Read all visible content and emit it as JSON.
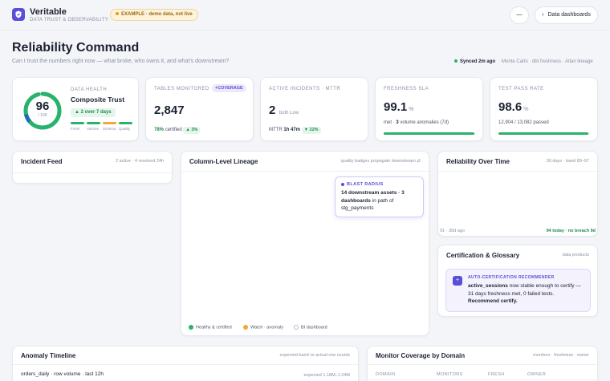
{
  "app": {
    "name": "Veritable",
    "tagline": "DATA TRUST & OBSERVABILITY"
  },
  "banner": {
    "label": "EXAMPLE · demo data, not live"
  },
  "header": {
    "menu_label": "—",
    "back_label": "Data dashboards"
  },
  "page": {
    "title": "Reliability Command",
    "subtitle": "Can I trust the numbers right now — what broke, who owns it, and what's downstream?",
    "sync_status": "Synced 2m ago",
    "sources": "Monte Carlo · dbt freshness · Atlan lineage"
  },
  "health": {
    "label": "DATA HEALTH",
    "score": "96",
    "score_sub": "/ 100",
    "score_value": 96,
    "title": "Composite Trust",
    "delta": "▲ 2 over 7 days",
    "segments": [
      {
        "label": "Fresh",
        "color": "#27b36b"
      },
      {
        "label": "Volume",
        "color": "#27b36b"
      },
      {
        "label": "Schema",
        "color": "#f0a838"
      },
      {
        "label": "Quality",
        "color": "#27b36b"
      }
    ],
    "ring_color": "#27b36b",
    "ring_accent": "#1d6fb8"
  },
  "kpis": {
    "tables": {
      "label": "TABLES MONITORED",
      "badge": "+COVERAGE",
      "value": "2,847",
      "pct": "78%",
      "pct_text": "certified",
      "delta": "▲ 3%"
    },
    "incidents": {
      "label": "ACTIVE INCIDENTS · MTTR",
      "value": "2",
      "value_note": "both Low",
      "mttr_label": "MTTR",
      "mttr_value": "1h 47m",
      "delta": "▼ 22%"
    },
    "freshness": {
      "label": "FRESHNESS SLA",
      "value": "99.1",
      "unit": "%",
      "detail_pre": "met ·",
      "detail_bold": "3",
      "detail_post": "volume anomalies (7d)",
      "progress": 0.991
    },
    "tests": {
      "label": "TEST PASS RATE",
      "value": "98.6",
      "unit": "%",
      "detail": "12,904 / 13,082 passed",
      "progress": 0.986
    }
  },
  "incident_feed": {
    "title": "Incident Feed",
    "meta": "2 active · 4 resolved 24h"
  },
  "lineage": {
    "title": "Column-Level Lineage",
    "meta": "quality badges propagate downstream ⇄",
    "callout_label": "BLAST RADIUS",
    "callout_bold": "14 downstream assets · 3 dashboards",
    "callout_text": "in path of stg_payments",
    "legend": [
      {
        "label": "Healthy & certified",
        "color": "#27b36b"
      },
      {
        "label": "Watch · anomaly",
        "color": "#f0a838"
      },
      {
        "label": "BI dashboard",
        "color": "#ffffff"
      }
    ]
  },
  "reliability": {
    "title": "Reliability Over Time",
    "meta": "30 days · band 89–97",
    "left_label": "91 · 30d ago",
    "right_label": "94 today · no breach 9d"
  },
  "certification": {
    "title": "Certification & Glossary",
    "meta": "data products",
    "rec_label": "AUTO-CERTIFICATION RECOMMENDER",
    "rec_bold": "active_sessions",
    "rec_text": "now stable enough to certify — 31 days freshness met, 0 failed tests.",
    "rec_action": "Recommend certify."
  },
  "anomaly": {
    "title": "Anomaly Timeline",
    "meta": "expected band vs actual row counts",
    "series_label": "orders_daily · row volume · last 12h",
    "expected": "expected 1.18M–1.24M"
  },
  "coverage": {
    "title": "Monitor Coverage by Domain",
    "meta": "monitors · freshness · owner",
    "columns": [
      "DOMAIN",
      "MONITORS",
      "FRESH",
      "OWNER"
    ]
  }
}
